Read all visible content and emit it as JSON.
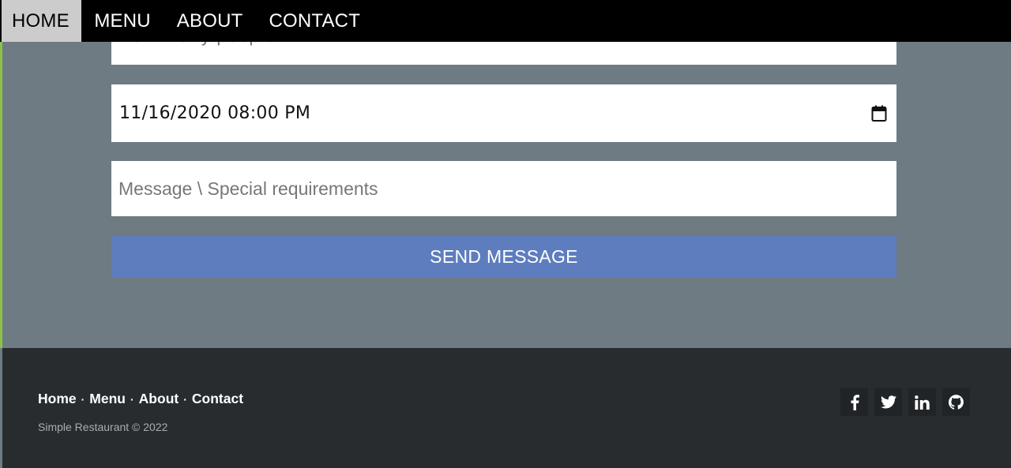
{
  "nav": {
    "items": [
      {
        "label": "HOME",
        "active": true
      },
      {
        "label": "MENU",
        "active": false
      },
      {
        "label": "ABOUT",
        "active": false
      },
      {
        "label": "CONTACT",
        "active": false
      }
    ]
  },
  "form": {
    "people_placeholder": "How many people",
    "datetime_value": "11/16/2020 08:00 PM",
    "message_placeholder": "Message \\ Special requirements",
    "send_label": "SEND MESSAGE",
    "send_color": "#5e7dbf"
  },
  "footer": {
    "links": [
      "Home",
      "Menu",
      "About",
      "Contact"
    ],
    "separator": "·",
    "copyright": "Simple Restaurant © 2022",
    "social_icons": [
      "facebook-icon",
      "twitter-icon",
      "linkedin-icon",
      "github-icon"
    ]
  },
  "colors": {
    "nav_bg": "#000000",
    "nav_active_bg": "#cccccc",
    "form_bg": "#6e7b82",
    "footer_bg": "#282c2f",
    "accent": "#8bc34a"
  }
}
